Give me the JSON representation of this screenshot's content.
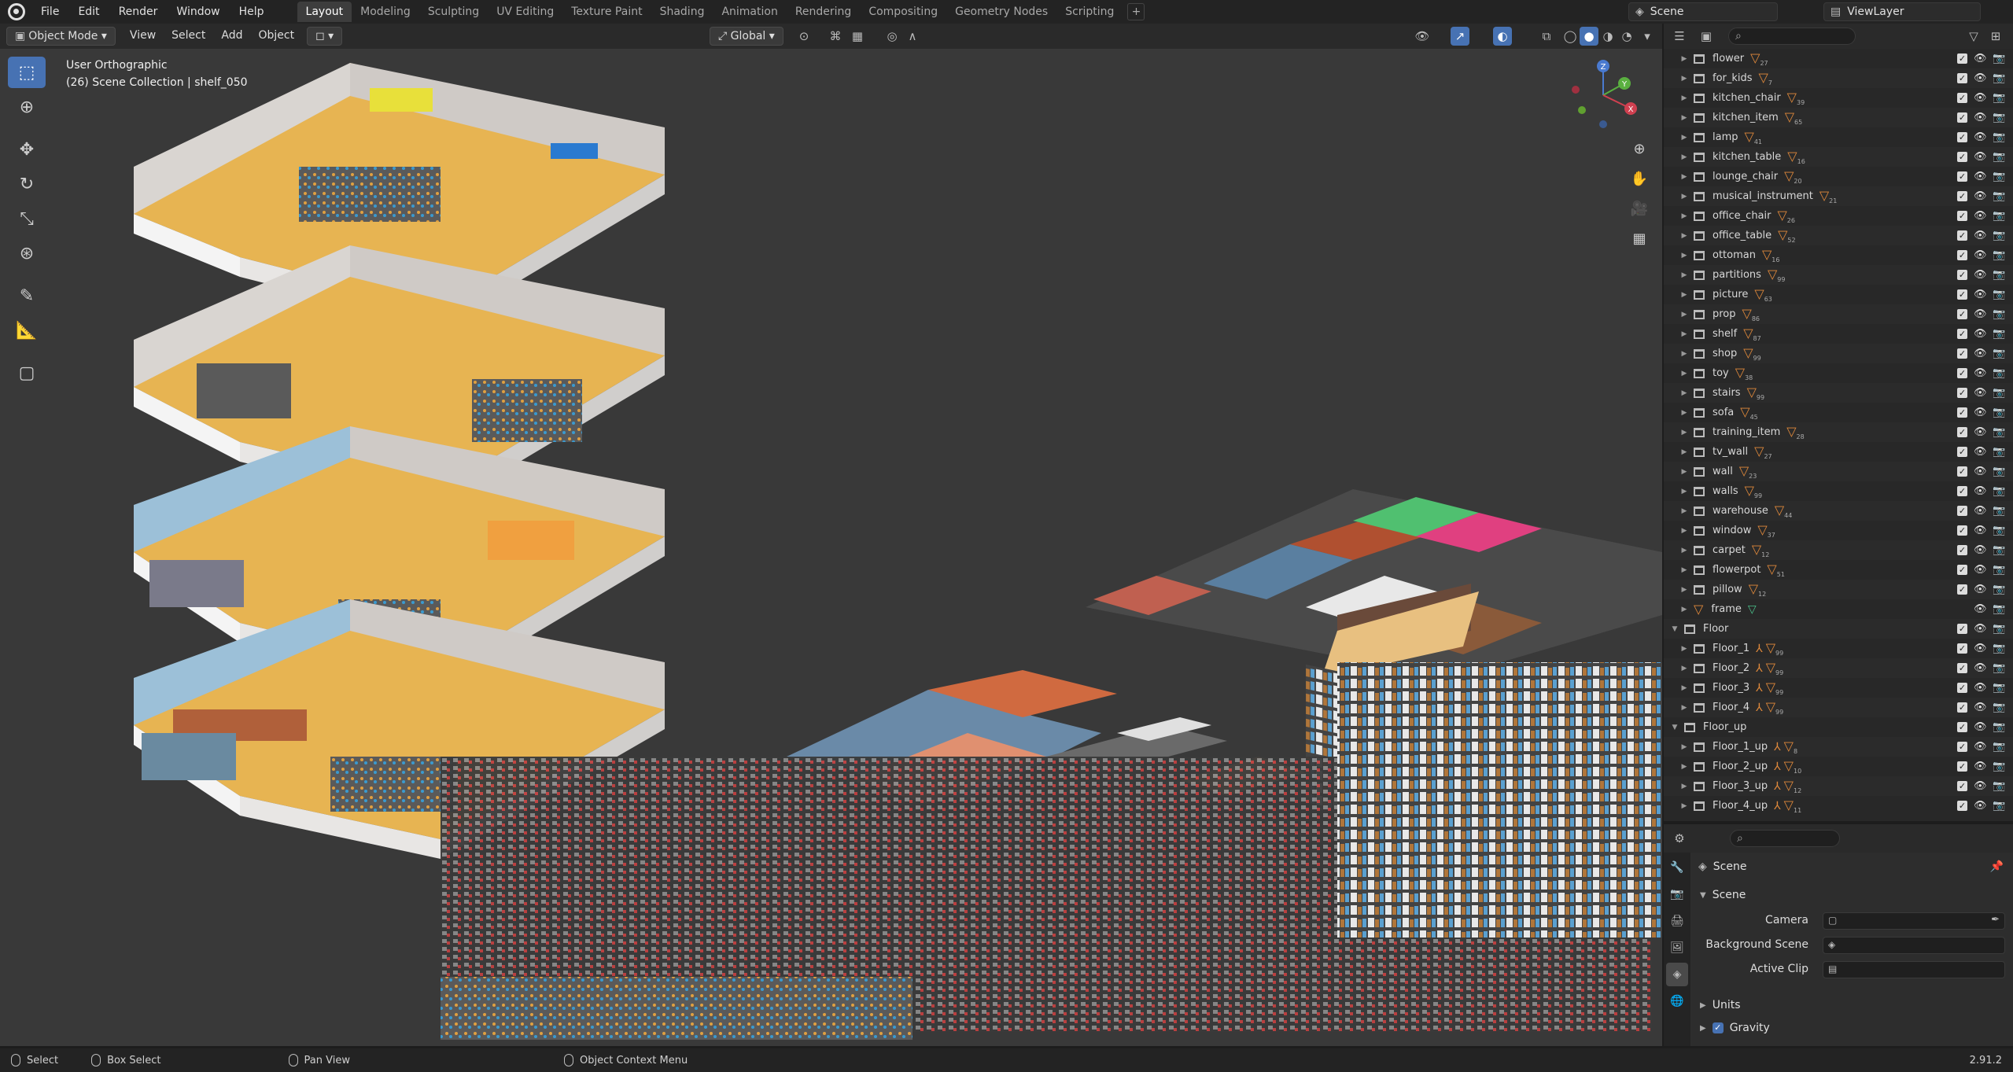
{
  "menu": [
    "File",
    "Edit",
    "Render",
    "Window",
    "Help"
  ],
  "workspaces": [
    "Layout",
    "Modeling",
    "Sculpting",
    "UV Editing",
    "Texture Paint",
    "Shading",
    "Animation",
    "Rendering",
    "Compositing",
    "Geometry Nodes",
    "Scripting"
  ],
  "active_workspace": "Layout",
  "scene_name": "Scene",
  "view_layer": "ViewLayer",
  "viewport_header": {
    "mode": "Object Mode",
    "menus": [
      "View",
      "Select",
      "Add",
      "Object"
    ],
    "orientation": "Global"
  },
  "viewport": {
    "view_name": "User Orthographic",
    "collection_info": "(26) Scene Collection | shelf_050",
    "gizmo_axes": [
      "Z",
      "Y",
      "X"
    ]
  },
  "outliner": {
    "items": [
      {
        "name": "flower",
        "count": "27",
        "expanded": false
      },
      {
        "name": "for_kids",
        "count": "7",
        "expanded": false
      },
      {
        "name": "kitchen_chair",
        "count": "39",
        "expanded": false
      },
      {
        "name": "kitchen_item",
        "count": "65",
        "expanded": false
      },
      {
        "name": "lamp",
        "count": "41",
        "expanded": false
      },
      {
        "name": "kitchen_table",
        "count": "16",
        "expanded": false
      },
      {
        "name": "lounge_chair",
        "count": "20",
        "expanded": false
      },
      {
        "name": "musical_instrument",
        "count": "21",
        "expanded": false
      },
      {
        "name": "office_chair",
        "count": "26",
        "expanded": false
      },
      {
        "name": "office_table",
        "count": "52",
        "expanded": false
      },
      {
        "name": "ottoman",
        "count": "16",
        "expanded": false
      },
      {
        "name": "partitions",
        "count": "99",
        "expanded": false
      },
      {
        "name": "picture",
        "count": "63",
        "expanded": false
      },
      {
        "name": "prop",
        "count": "86",
        "expanded": false
      },
      {
        "name": "shelf",
        "count": "87",
        "expanded": false
      },
      {
        "name": "shop",
        "count": "99",
        "expanded": false
      },
      {
        "name": "toy",
        "count": "38",
        "expanded": false
      },
      {
        "name": "stairs",
        "count": "99",
        "expanded": false
      },
      {
        "name": "sofa",
        "count": "45",
        "expanded": false
      },
      {
        "name": "training_item",
        "count": "28",
        "expanded": false
      },
      {
        "name": "tv_wall",
        "count": "27",
        "expanded": false
      },
      {
        "name": "wall",
        "count": "23",
        "expanded": false
      },
      {
        "name": "walls",
        "count": "99",
        "expanded": false
      },
      {
        "name": "warehouse",
        "count": "44",
        "expanded": false
      },
      {
        "name": "window",
        "count": "37",
        "expanded": false
      },
      {
        "name": "carpet",
        "count": "12",
        "expanded": false
      },
      {
        "name": "flowerpot",
        "count": "51",
        "expanded": false
      },
      {
        "name": "pillow",
        "count": "12",
        "expanded": false
      },
      {
        "name": "frame",
        "count": "",
        "expanded": false
      }
    ],
    "floor_group": {
      "name": "Floor",
      "children": [
        {
          "name": "Floor_1",
          "count": "99"
        },
        {
          "name": "Floor_2",
          "count": "99"
        },
        {
          "name": "Floor_3",
          "count": "99"
        },
        {
          "name": "Floor_4",
          "count": "99"
        }
      ]
    },
    "floor_up_group": {
      "name": "Floor_up",
      "children": [
        {
          "name": "Floor_1_up",
          "count": "8"
        },
        {
          "name": "Floor_2_up",
          "count": "10"
        },
        {
          "name": "Floor_3_up",
          "count": "12"
        },
        {
          "name": "Floor_4_up",
          "count": "11"
        }
      ]
    }
  },
  "properties": {
    "title": "Scene",
    "panel": "Scene",
    "camera_label": "Camera",
    "background_label": "Background Scene",
    "clip_label": "Active Clip",
    "units_label": "Units",
    "gravity_label": "Gravity"
  },
  "statusbar": {
    "select": "Select",
    "box_select": "Box Select",
    "pan_view": "Pan View",
    "context_menu": "Object Context Menu",
    "version": "2.91.2"
  },
  "colors": {
    "accent": "#4772b3",
    "object_orange": "#e0893b",
    "floor": "#e7b452",
    "wall": "#d8d4d0",
    "viewport_bg": "#393939"
  }
}
